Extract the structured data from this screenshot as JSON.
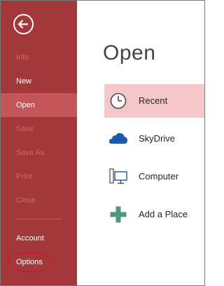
{
  "backstage": {
    "back_label": "Back",
    "items": [
      {
        "label": "Info",
        "enabled": false
      },
      {
        "label": "New",
        "enabled": true
      },
      {
        "label": "Open",
        "enabled": true,
        "selected": true
      },
      {
        "label": "Save",
        "enabled": false
      },
      {
        "label": "Save As",
        "enabled": false
      },
      {
        "label": "Print",
        "enabled": false
      },
      {
        "label": "Close",
        "enabled": false
      },
      {
        "label": "Account",
        "enabled": true
      },
      {
        "label": "Options",
        "enabled": true
      }
    ]
  },
  "main": {
    "title": "Open",
    "places": [
      {
        "label": "Recent",
        "icon": "clock-icon",
        "selected": true
      },
      {
        "label": "SkyDrive",
        "icon": "cloud-icon"
      },
      {
        "label": "Computer",
        "icon": "computer-icon"
      },
      {
        "label": "Add a Place",
        "icon": "plus-icon"
      }
    ]
  },
  "colors": {
    "nav_bg": "#a4373a",
    "nav_selected": "#c45558",
    "recent_highlight": "#f5c7c8",
    "annotation_circle": "#d8131b"
  }
}
